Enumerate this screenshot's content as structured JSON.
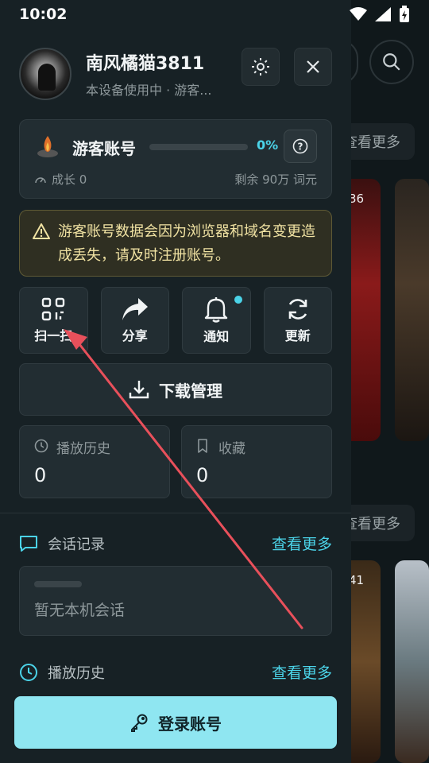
{
  "status_bar": {
    "time": "10:02"
  },
  "profile": {
    "username": "南风橘猫3811",
    "subtitle": "本设备使用中 · 游客..."
  },
  "guest_card": {
    "title": "游客账号",
    "progress_percent": "0%",
    "progress_value": 0,
    "growth": "成长 0",
    "remaining": "剩余 90万 词元"
  },
  "warning": {
    "text": "游客账号数据会因为浏览器和域名变更造成丢失，请及时注册账号。"
  },
  "actions": {
    "scan": "扫一扫",
    "share": "分享",
    "notify": "通知",
    "update": "更新"
  },
  "download": {
    "label": "下载管理"
  },
  "stats": {
    "history_label": "播放历史",
    "history_value": "0",
    "favorites_label": "收藏",
    "favorites_value": "0"
  },
  "sessions": {
    "title": "会话记录",
    "see_more": "查看更多",
    "empty_text": "暂无本机会话"
  },
  "history_section": {
    "title": "播放历史",
    "see_more": "查看更多"
  },
  "login": {
    "label": "登录账号"
  },
  "background": {
    "see_more_1": "查看更多",
    "see_more_2": "查看更多",
    "badge_1": "36",
    "badge_2": "41"
  },
  "colors": {
    "accent": "#4bd3e8",
    "login_button": "#8fe6f1",
    "warning_bg": "#2f2f22",
    "annotation_arrow": "#e8505b"
  }
}
